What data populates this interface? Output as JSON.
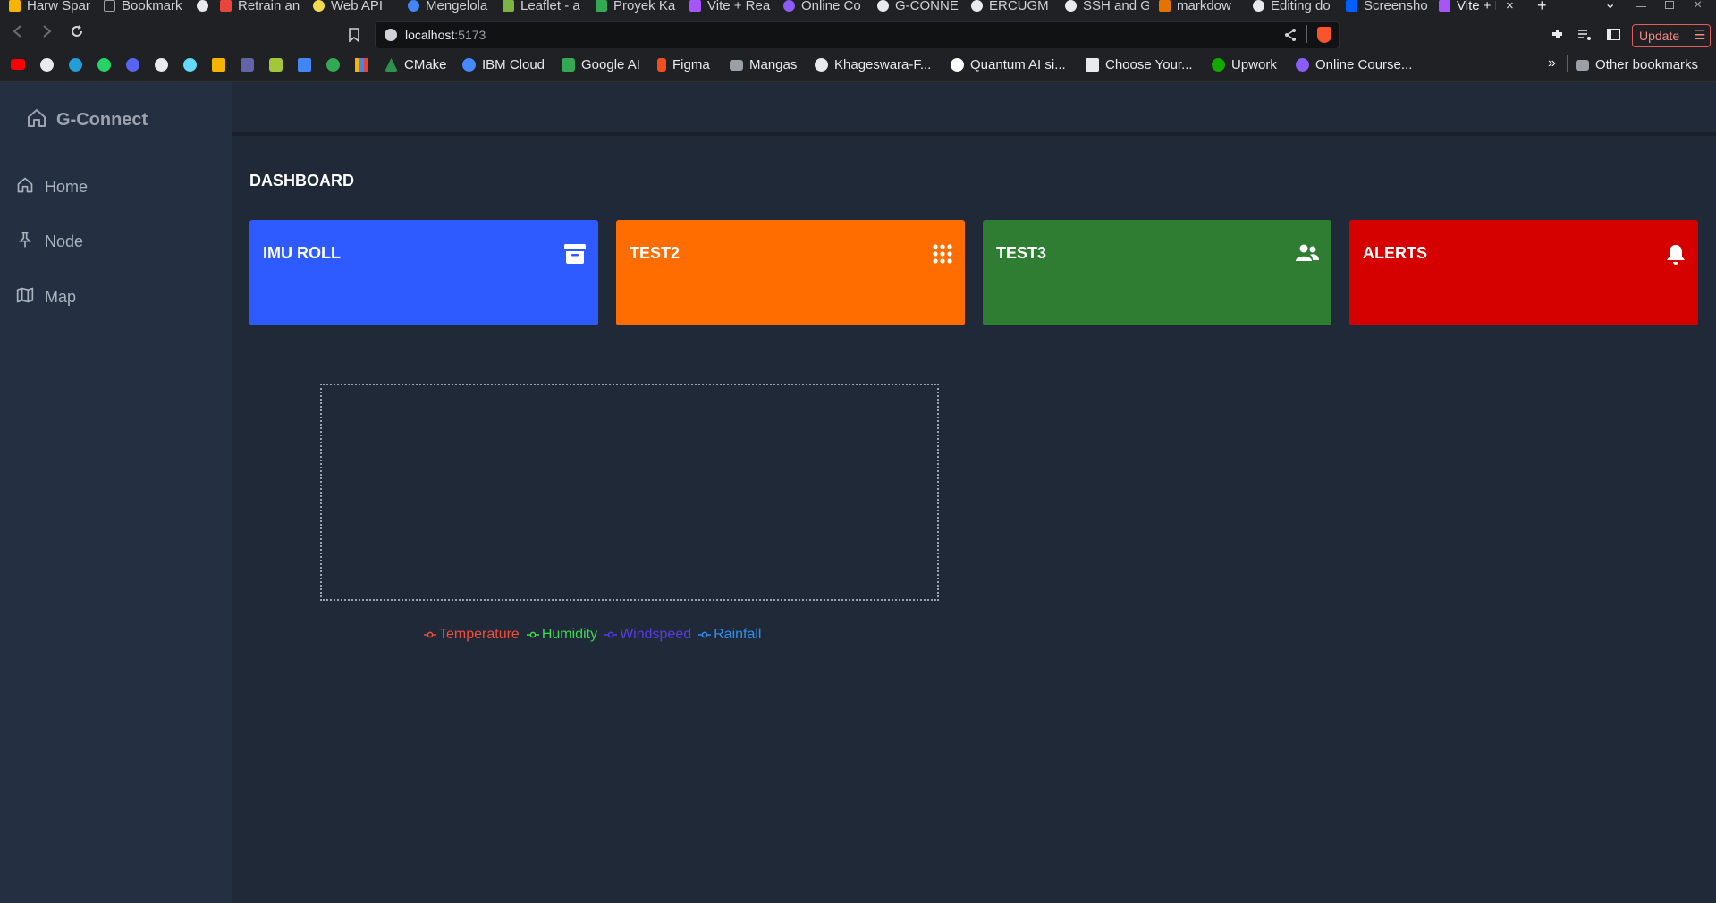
{
  "browser": {
    "tabs": [
      {
        "label": "Harw Spar",
        "color": "#f4b400"
      },
      {
        "label": "Bookmark",
        "color": "#9aa0a6"
      },
      {
        "label": "",
        "color": "#e8eaed"
      },
      {
        "label": "Retrain an",
        "color": "#e8453c"
      },
      {
        "label": "Web API",
        "color": "#f0db4f"
      },
      {
        "label": "Mengelola",
        "color": "#4285f4"
      },
      {
        "label": "Leaflet - a",
        "color": "#7cb342"
      },
      {
        "label": "Proyek Ka",
        "color": "#34a853"
      },
      {
        "label": "Vite + Rea",
        "color": "#a855f7"
      },
      {
        "label": "Online Co",
        "color": "#8b5cf6"
      },
      {
        "label": "G-CONNE",
        "color": "#e8eaed"
      },
      {
        "label": "ERCUGM",
        "color": "#e8eaed"
      },
      {
        "label": "SSH and G",
        "color": "#e8eaed"
      },
      {
        "label": "markdow",
        "color": "#e37400"
      },
      {
        "label": "Editing do",
        "color": "#e8eaed"
      },
      {
        "label": "Screensho",
        "color": "#0061fe"
      },
      {
        "label": "Vite + R",
        "color": "#a855f7"
      }
    ],
    "new_tab_glyph": "+",
    "close_glyph": "×",
    "tab_list_glyph": "⌄",
    "url_host": "localhost",
    "url_port": ":5173",
    "update_label": "Update",
    "bookmarks": [
      {
        "label": "CMake",
        "color": "#2f8f4e"
      },
      {
        "label": "IBM Cloud",
        "color": "#4589ff"
      },
      {
        "label": "Google AI",
        "color": "#34a853"
      },
      {
        "label": "Figma",
        "color": "#f24e1e"
      },
      {
        "label": "Mangas",
        "color": "#9aa0a6"
      },
      {
        "label": "Khageswara-F...",
        "color": "#e8eaed"
      },
      {
        "label": "Quantum AI si...",
        "color": "#ffffff"
      },
      {
        "label": "Choose Your...",
        "color": "#e8eaed"
      },
      {
        "label": "Upwork",
        "color": "#14a800"
      },
      {
        "label": "Online Course...",
        "color": "#8b5cf6"
      }
    ],
    "bookmark_icons": [
      "#ff0000",
      "#e8eaed",
      "#229ed9",
      "#25d366",
      "#5865f2",
      "#e8eaed",
      "#61dafb",
      "#f4b400",
      "#6264a7",
      "#a4c639",
      "#4285f4",
      "#34a853",
      "#f4b400"
    ],
    "overflow_glyph": "»",
    "other_bookmarks": "Other bookmarks"
  },
  "app": {
    "brand": "G-Connect",
    "nav": [
      {
        "label": "Home",
        "icon": "home-icon"
      },
      {
        "label": "Node",
        "icon": "pin-icon"
      },
      {
        "label": "Map",
        "icon": "map-icon"
      }
    ],
    "page_title": "DASHBOARD",
    "cards": [
      {
        "title": "IMU ROLL",
        "color": "#2d5bff",
        "icon": "archive-icon"
      },
      {
        "title": "TEST2",
        "color": "#ff6d00",
        "icon": "grid-icon"
      },
      {
        "title": "TEST3",
        "color": "#2e7d32",
        "icon": "users-icon"
      },
      {
        "title": "ALERTS",
        "color": "#d50000",
        "icon": "bell-icon"
      }
    ],
    "legend": [
      {
        "label": "Temperature",
        "color": "#ef4e3a"
      },
      {
        "label": "Humidity",
        "color": "#3ddc4e"
      },
      {
        "label": "Windspeed",
        "color": "#5b3be8"
      },
      {
        "label": "Rainfall",
        "color": "#2f8ff0"
      }
    ]
  }
}
